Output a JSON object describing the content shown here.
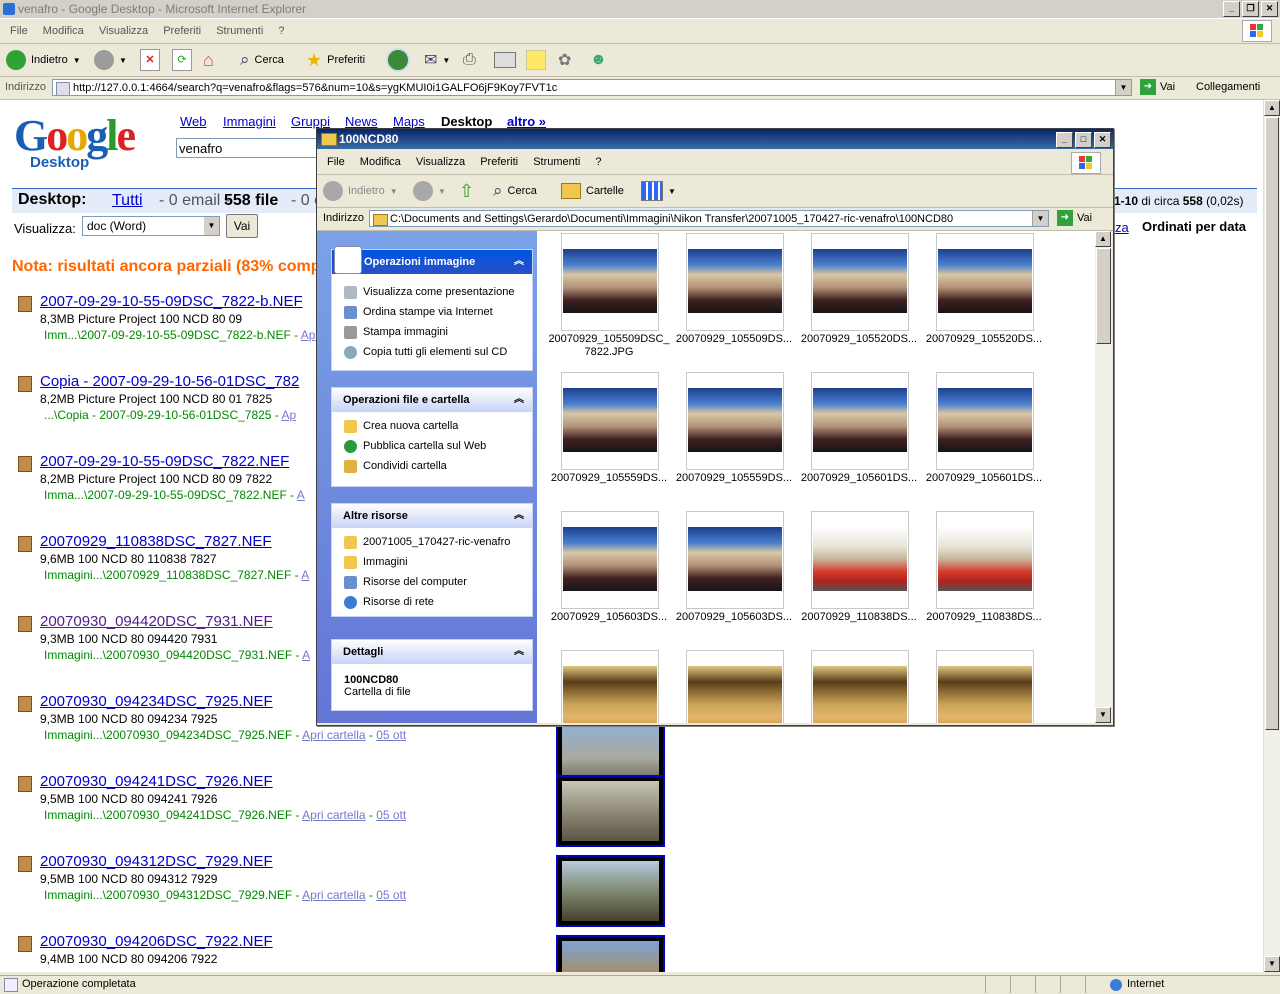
{
  "ie": {
    "title": "venafro - Google Desktop - Microsoft Internet Explorer",
    "menu": [
      "File",
      "Modifica",
      "Visualizza",
      "Preferiti",
      "Strumenti",
      "?"
    ],
    "toolbar": {
      "back": "Indietro",
      "search": "Cerca",
      "favorites": "Preferiti"
    },
    "address_label": "Indirizzo",
    "address": "http://127.0.0.1:4664/search?q=venafro&flags=576&num=10&s=ygKMUI0i1GALFO6jF9Koy7FVT1c",
    "go": "Vai",
    "links": "Collegamenti",
    "status": "Operazione completata",
    "zone": "Internet"
  },
  "google": {
    "logo_letters": [
      "G",
      "o",
      "o",
      "g",
      "l",
      "e"
    ],
    "logo_sub": "Desktop",
    "nav": [
      "Web",
      "Immagini",
      "Gruppi",
      "News",
      "Maps",
      "Desktop",
      "altro »"
    ],
    "query": "venafro",
    "bar": {
      "label": "Desktop:",
      "all": "Tutti",
      "email": "- 0 email -",
      "files": "558 file",
      "rest": "- 0 c",
      "range": "1-10",
      "of": "di circa",
      "count": "558",
      "time": "(0,02s)"
    },
    "view_label": "Visualizza:",
    "view_value": "doc (Word)",
    "view_button": "Vai",
    "sort_link": "za",
    "sorted": "Ordinati per data",
    "note": "Nota: risultati ancora parziali (83% comp",
    "open_folder": "Apri cartella",
    "date": "05 ott",
    "results": [
      {
        "title": "2007-09-29-10-55-09DSC_7822-b.NEF",
        "meta": "8,3MB Picture Project 100 NCD 80 09",
        "path": "Imm...\\2007-09-29-10-55-09DSC_7822-b.NEF -",
        "link": "Ap"
      },
      {
        "title": "Copia - 2007-09-29-10-56-01DSC_782",
        "meta": "8,2MB Picture Project 100 NCD 80 01 7825",
        "path": "...\\Copia - 2007-09-29-10-56-01DSC_7825 -",
        "link": "Ap"
      },
      {
        "title": "2007-09-29-10-55-09DSC_7822.NEF",
        "meta": "8,2MB Picture Project 100 NCD 80 09 7822",
        "path": "Imma...\\2007-09-29-10-55-09DSC_7822.NEF -",
        "link": "A"
      },
      {
        "title": "20070929_110838DSC_7827.NEF",
        "meta": "9,6MB 100 NCD 80 110838 7827",
        "path": "Immagini...\\20070929_110838DSC_7827.NEF -",
        "link": "A"
      },
      {
        "title": "20070930_094420DSC_7931.NEF",
        "meta": "9,3MB 100 NCD 80 094420 7931",
        "path": "Immagini...\\20070930_094420DSC_7931.NEF -",
        "link": "A"
      },
      {
        "title": "20070930_094234DSC_7925.NEF",
        "meta": "9,3MB 100 NCD 80 094234 7925",
        "path": "Immagini...\\20070930_094234DSC_7925.NEF -",
        "link": "Apri cartella",
        "date": "05 ott"
      },
      {
        "title": "20070930_094241DSC_7926.NEF",
        "meta": "9,5MB 100 NCD 80 094241 7926",
        "path": "Immagini...\\20070930_094241DSC_7926.NEF -",
        "link": "Apri cartella",
        "date": "05 ott"
      },
      {
        "title": "20070930_094312DSC_7929.NEF",
        "meta": "9,5MB 100 NCD 80 094312 7929",
        "path": "Immagini...\\20070930_094312DSC_7929.NEF -",
        "link": "Apri cartella",
        "date": "05 ott"
      },
      {
        "title": "20070930_094206DSC_7922.NEF",
        "meta": "9,4MB 100 NCD 80 094206 7922",
        "path": "",
        "link": ""
      }
    ]
  },
  "explorer": {
    "title": "100NCD80",
    "menu": [
      "File",
      "Modifica",
      "Visualizza",
      "Preferiti",
      "Strumenti",
      "?"
    ],
    "toolbar": {
      "back": "Indietro",
      "search": "Cerca",
      "folders": "Cartelle"
    },
    "address_label": "Indirizzo",
    "address": "C:\\Documents and Settings\\Gerardo\\Documenti\\Immagini\\Nikon Transfer\\20071005_170427-ric-venafro\\100NCD80",
    "go": "Vai",
    "panels": {
      "image": {
        "title": "Operazioni immagine",
        "items": [
          "Visualizza come presentazione",
          "Ordina stampe via Internet",
          "Stampa immagini",
          "Copia tutti gli elementi sul CD"
        ]
      },
      "file": {
        "title": "Operazioni file e cartella",
        "items": [
          "Crea nuova cartella",
          "Pubblica cartella sul Web",
          "Condividi cartella"
        ]
      },
      "other": {
        "title": "Altre risorse",
        "items": [
          "20071005_170427-ric-venafro",
          "Immagini",
          "Risorse del computer",
          "Risorse di rete"
        ]
      },
      "details": {
        "title": "Dettagli",
        "name": "100NCD80",
        "type": "Cartella di file"
      }
    },
    "files": [
      "20070929_105509DSC_\n7822.JPG",
      "20070929_105509DS...",
      "20070929_105520DS...",
      "20070929_105520DS...",
      "20070929_105559DS...",
      "20070929_105559DS...",
      "20070929_105601DS...",
      "20070929_105601DS...",
      "20070929_105603DS...",
      "20070929_105603DS...",
      "20070929_110838DS...",
      "20070929_110838DS...",
      "",
      "",
      "",
      ""
    ]
  }
}
